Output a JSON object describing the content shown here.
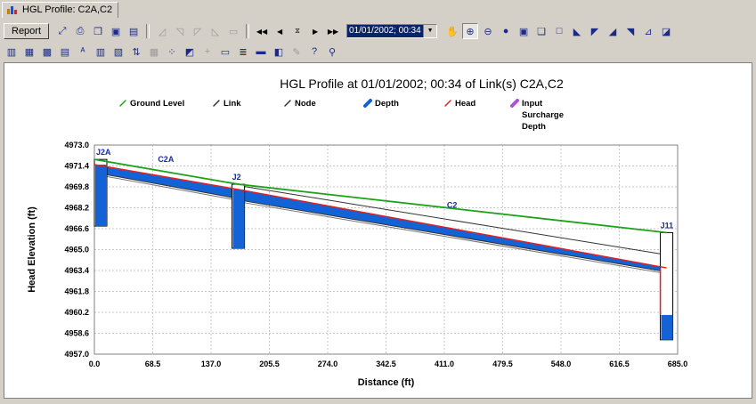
{
  "window": {
    "tab_title": "HGL Profile: C2A,C2"
  },
  "toolbar": {
    "report_label": "Report",
    "date_combo_value": "01/01/2002; 00:34",
    "row1_icons_a": [
      "zoom-tool-icon",
      "print-icon",
      "copy-icon",
      "save-icon",
      "export-icon"
    ],
    "row1_icons_b": [
      "chart-type-1-icon",
      "chart-type-2-icon",
      "chart-type-3-icon",
      "chart-type-4-icon",
      "chart-type-5-icon"
    ],
    "row1_playback": [
      "◀◀",
      "◀",
      "⧖",
      "▶",
      "▶▶"
    ],
    "row1_icons_c": [
      "pan-hand-icon",
      "zoom-in-icon",
      "zoom-out-icon",
      "globe-icon",
      "floppy-icon",
      "copy-chart-icon",
      "note-icon",
      "profile-1-icon",
      "profile-2-icon",
      "profile-3-icon",
      "profile-4-icon",
      "profile-5-icon",
      "profile-6-icon"
    ],
    "row2_icons": [
      "bar-chart-icon",
      "3d-bar-icon",
      "grid-chart-icon",
      "table-view-icon",
      "abc-label-icon",
      "bar-grid-icon",
      "stack-icon",
      "sort-az-icon",
      "gray-grid-icon",
      "scatter-icon",
      "area-icon",
      "plus-icon",
      "legend-icon",
      "list-icon",
      "rect-icon",
      "edit-chart-icon",
      "pencil-icon",
      "help-icon",
      "magnifier-icon"
    ]
  },
  "chart_data": {
    "type": "line",
    "title": "HGL Profile at 01/01/2002;  00:34 of Link(s) C2A,C2",
    "xlabel": "Distance (ft)",
    "ylabel": "Head Elevation (ft)",
    "xlim": [
      0.0,
      685.0
    ],
    "ylim": [
      4957.0,
      4973.0
    ],
    "x_ticks": [
      "0.0",
      "68.5",
      "137.0",
      "205.5",
      "274.0",
      "342.5",
      "411.0",
      "479.5",
      "548.0",
      "616.5",
      "685.0"
    ],
    "y_ticks": [
      "4957.0",
      "4958.6",
      "4960.2",
      "4961.8",
      "4963.4",
      "4965.0",
      "4966.6",
      "4968.2",
      "4969.8",
      "4971.4",
      "4973.0"
    ],
    "grid": true,
    "legend": [
      {
        "label": "Ground Level",
        "color": "#1aa31a"
      },
      {
        "label": "Link",
        "color": "#333333"
      },
      {
        "label": "Node",
        "color": "#333333"
      },
      {
        "label": "Depth",
        "color": "#1463d6"
      },
      {
        "label": "Head",
        "color": "#e02020"
      },
      {
        "label": "Input\nSurcharge\nDepth",
        "color": "#b050d8"
      }
    ],
    "series": [
      {
        "name": "Ground Level",
        "x": [
          0,
          169,
          672
        ],
        "values": [
          4971.9,
          4970.0,
          4966.3
        ]
      },
      {
        "name": "Head",
        "x": [
          0,
          169,
          672
        ],
        "values": [
          4971.5,
          4969.6,
          4963.6
        ]
      }
    ],
    "pipe_crown": {
      "x": [
        0,
        169,
        169,
        672
      ],
      "values": [
        4971.9,
        4970.0,
        4969.9,
        4964.6
      ]
    },
    "pipe_invert": {
      "x": [
        0,
        169,
        169,
        672
      ],
      "values": [
        4970.9,
        4968.9,
        4968.8,
        4963.3
      ]
    },
    "nodes": [
      {
        "name": "J2A",
        "x": 0,
        "invert": 4966.8,
        "top": 4971.9
      },
      {
        "name": "J2",
        "x": 169,
        "invert": 4965.1,
        "top": 4970.0
      },
      {
        "name": "J11",
        "x": 672,
        "invert": 4958.1,
        "top": 4966.3
      }
    ],
    "link_labels": [
      {
        "name": "C2A",
        "x": 84,
        "y": 4971.7
      },
      {
        "name": "C2",
        "x": 420,
        "y": 4968.2
      }
    ]
  }
}
